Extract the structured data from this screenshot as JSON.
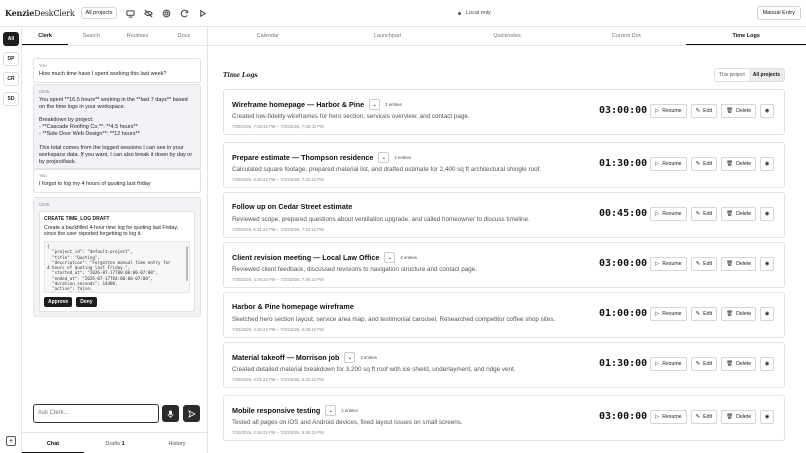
{
  "app": {
    "brand_bold": "Kenzie",
    "brand_rest": "DeskClerk",
    "project_filter": "All projects",
    "status": "Local only",
    "manual_entry": "Manual Entry"
  },
  "rail": {
    "items": [
      "All",
      "DP",
      "CR",
      "SD"
    ],
    "add_icon": "+"
  },
  "clerk": {
    "tabs": [
      "Clerk",
      "Search",
      "Routines",
      "Docs"
    ],
    "messages": [
      {
        "who": "You",
        "text": "How much time have I spent working this last week?"
      },
      {
        "who": "Clerk",
        "text": "You spent **16.5 hours** working in the **last 7 days** based on the time logs in your workspace.\n\nBreakdown by project:\n- **Cascade Roofing Co.**: **4.5 hours**\n- **Side Door Web Design**: **12 hours**\n\nThis total comes from the logged sessions I can see in your workspace data. If you want, I can also break it down by day or by project/task."
      },
      {
        "who": "You",
        "text": "I forgot to log my 4 hours of quoting last friday"
      },
      {
        "who": "Clerk",
        "draft_title": "CREATE TIME_LOG DRAFT",
        "draft_desc": "Create a backfilled 4-hour time log for quoting last Friday, since the user reported forgetting to log it.",
        "code": "{\n  \"project_id\": \"default-project\",\n  \"title\": \"Quoting\",\n  \"description\": \"Forgotten manual time entry for\n4 hours of quoting last Friday.\",\n  \"started_at\": \"2026-07-17T00:00:00-07:00\",\n  \"ended_at\": \"2026-07-17T04:00:00-07:00\",\n  \"duration_seconds\": 14400,\n  \"active\": false,\n  \"paused\": false,",
        "approve": "Approve",
        "deny": "Deny"
      }
    ],
    "ask_placeholder": "Ask Clerk...",
    "bottom_tabs": {
      "chat": "Chat",
      "drafts": "Drafts",
      "drafts_count": "1",
      "history": "History"
    }
  },
  "main": {
    "tabs": [
      "Calendar",
      "Launchpad",
      "Quicknotes",
      "Current Doc",
      "Time Logs"
    ],
    "section_title": "Time Logs",
    "scope": {
      "this_project": "This project",
      "all_projects": "All projects"
    },
    "actions": {
      "resume": "Resume",
      "edit": "Edit",
      "delete": "Delete"
    },
    "logs": [
      {
        "title": "Wireframe homepage — Harbor & Pine",
        "entries": "2 entries",
        "desc": "Created low-fidelity wireframes for hero section, services overview, and contact page.",
        "meta": "7/20/2026, 7:06:32 PM – 7/20/2026, 7:06:32 PM",
        "duration": "03:00:00"
      },
      {
        "title": "Prepare estimate — Thompson residence",
        "entries": "2 entries",
        "desc": "Calculated square footage, prepared material list, and drafted estimate for 2,400 sq ft architectural shingle roof.",
        "meta": "7/20/2026, 6:46:22 PM – 7/20/2026, 7:31:22 PM",
        "duration": "01:30:00"
      },
      {
        "title": "Follow up on Cedar Street estimate",
        "entries": "",
        "desc": "Reviewed scope, prepared questions about ventilation upgrade, and called homeowner to discuss timeline.",
        "meta": "7/20/2026, 6:31:22 PM – 7/20/2026, 7:16:22 PM",
        "duration": "00:45:00"
      },
      {
        "title": "Client revision meeting — Local Law Office",
        "entries": "2 entries",
        "desc": "Reviewed client feedback, discussed revisions to navigation structure and contact page.",
        "meta": "7/20/2026, 4:46:22 PM – 7/20/2026, 7:46:22 PM",
        "duration": "03:00:00"
      },
      {
        "title": "Harbor & Pine homepage wireframe",
        "entries": "",
        "desc": "Sketched hero section layout, service area map, and testimonial carousel. Researched competitor coffee shop sites.",
        "meta": "7/20/2026, 4:46:22 PM – 7/20/2026, 5:46:22 PM",
        "duration": "01:00:00"
      },
      {
        "title": "Material takeoff — Morrison job",
        "entries": "2 entries",
        "desc": "Created detailed material breakdown for 3,200 sq ft roof with ice shield, underlayment, and ridge vent.",
        "meta": "7/20/2026, 4:01:22 PM – 7/20/2026, 5:31:22 PM",
        "duration": "01:30:00"
      },
      {
        "title": "Mobile responsive testing",
        "entries": "2 entries",
        "desc": "Tested all pages on iOS and Android devices, fixed layout issues on small screens.",
        "meta": "7/20/2026, 2:46:22 PM – 7/20/2026, 5:46:22 PM",
        "duration": "03:00:00"
      }
    ]
  }
}
